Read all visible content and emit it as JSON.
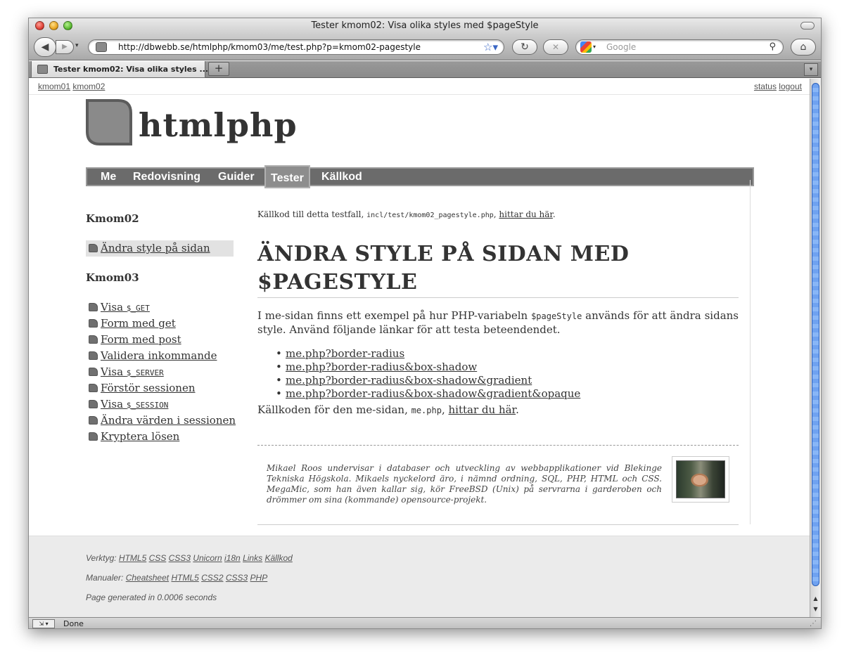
{
  "window": {
    "title": "Tester kmom02: Visa olika styles med $pageStyle",
    "url": "http://dbwebb.se/htmlphp/kmom03/me/test.php?p=kmom02-pagestyle",
    "search_placeholder": "Google",
    "tab_title": "Tester kmom02: Visa olika styles ...",
    "tab_new": "+",
    "status": "Done"
  },
  "topnav": {
    "left": [
      "kmom01",
      "kmom02"
    ],
    "right": [
      "status",
      "logout"
    ]
  },
  "site": {
    "title": "htmlphp"
  },
  "navbar": {
    "items": [
      "Me",
      "Redovisning",
      "Guider",
      "Tester",
      "Källkod"
    ],
    "active": "Tester"
  },
  "sidebar": {
    "section1": {
      "heading": "Kmom02",
      "items": [
        "Ändra style på sidan"
      ]
    },
    "section2": {
      "heading": "Kmom03",
      "items": [
        {
          "text": "Visa ",
          "code": "$_GET"
        },
        {
          "text": "Form med get"
        },
        {
          "text": "Form med post"
        },
        {
          "text": "Validera inkommande"
        },
        {
          "text": "Visa ",
          "code": "$_SERVER"
        },
        {
          "text": "Förstör sessionen"
        },
        {
          "text": "Visa ",
          "code": "$_SESSION"
        },
        {
          "text": "Ändra värden i sessionen"
        },
        {
          "text": "Kryptera lösen"
        }
      ]
    }
  },
  "main": {
    "src_note_prefix": "Källkod till detta testfall, ",
    "src_note_file": "incl/test/kmom02_pagestyle.php",
    "src_note_sep": ", ",
    "src_note_link": "hittar du här",
    "src_note_end": ".",
    "heading_line1": "ÄNDRA STYLE PÅ SIDAN MED",
    "heading_line2": "$PAGESTYLE",
    "intro_before": "I me-sidan finns ett exempel på hur PHP-variabeln ",
    "intro_code": "$pageStyle",
    "intro_after": " används för att ändra sidans style. Använd följande länkar för att testa beteendendet.",
    "examples": [
      "me.php?border-radius",
      "me.php?border-radius&box-shadow",
      "me.php?border-radius&box-shadow&gradient",
      "me.php?border-radius&box-shadow&gradient&opaque"
    ],
    "source_prefix": "Källkoden för den me-sidan, ",
    "source_code": "me.php",
    "source_sep": ", ",
    "source_link": "hittar du här",
    "source_end": "."
  },
  "byline": {
    "text": "Mikael Roos undervisar i databaser och utveckling av webbapplikationer vid Blekinge Tekniska Högskola. Mikaels nyckelord äro, i nämnd ordning, SQL, PHP, HTML och CSS. MegaMic, som han även kallar sig, kör FreeBSD (Unix) på servrarna i garderoben och drömmer om sina (kommande) opensource-projekt."
  },
  "footer": {
    "tools_label": "Verktyg:",
    "tools": [
      "HTML5",
      "CSS",
      "CSS3",
      "Unicorn",
      "i18n",
      "Links",
      "Källkod"
    ],
    "manuals_label": "Manualer:",
    "manuals": [
      "Cheatsheet",
      "HTML5",
      "CSS2",
      "CSS3",
      "PHP"
    ],
    "generated": "Page generated in 0.0006 seconds"
  },
  "icons": {
    "back": "back-arrow-icon",
    "forward": "forward-arrow-icon",
    "reload": "reload-icon",
    "stop": "stop-icon",
    "home": "home-icon",
    "bookmark": "star-icon",
    "search": "magnifier-icon"
  }
}
